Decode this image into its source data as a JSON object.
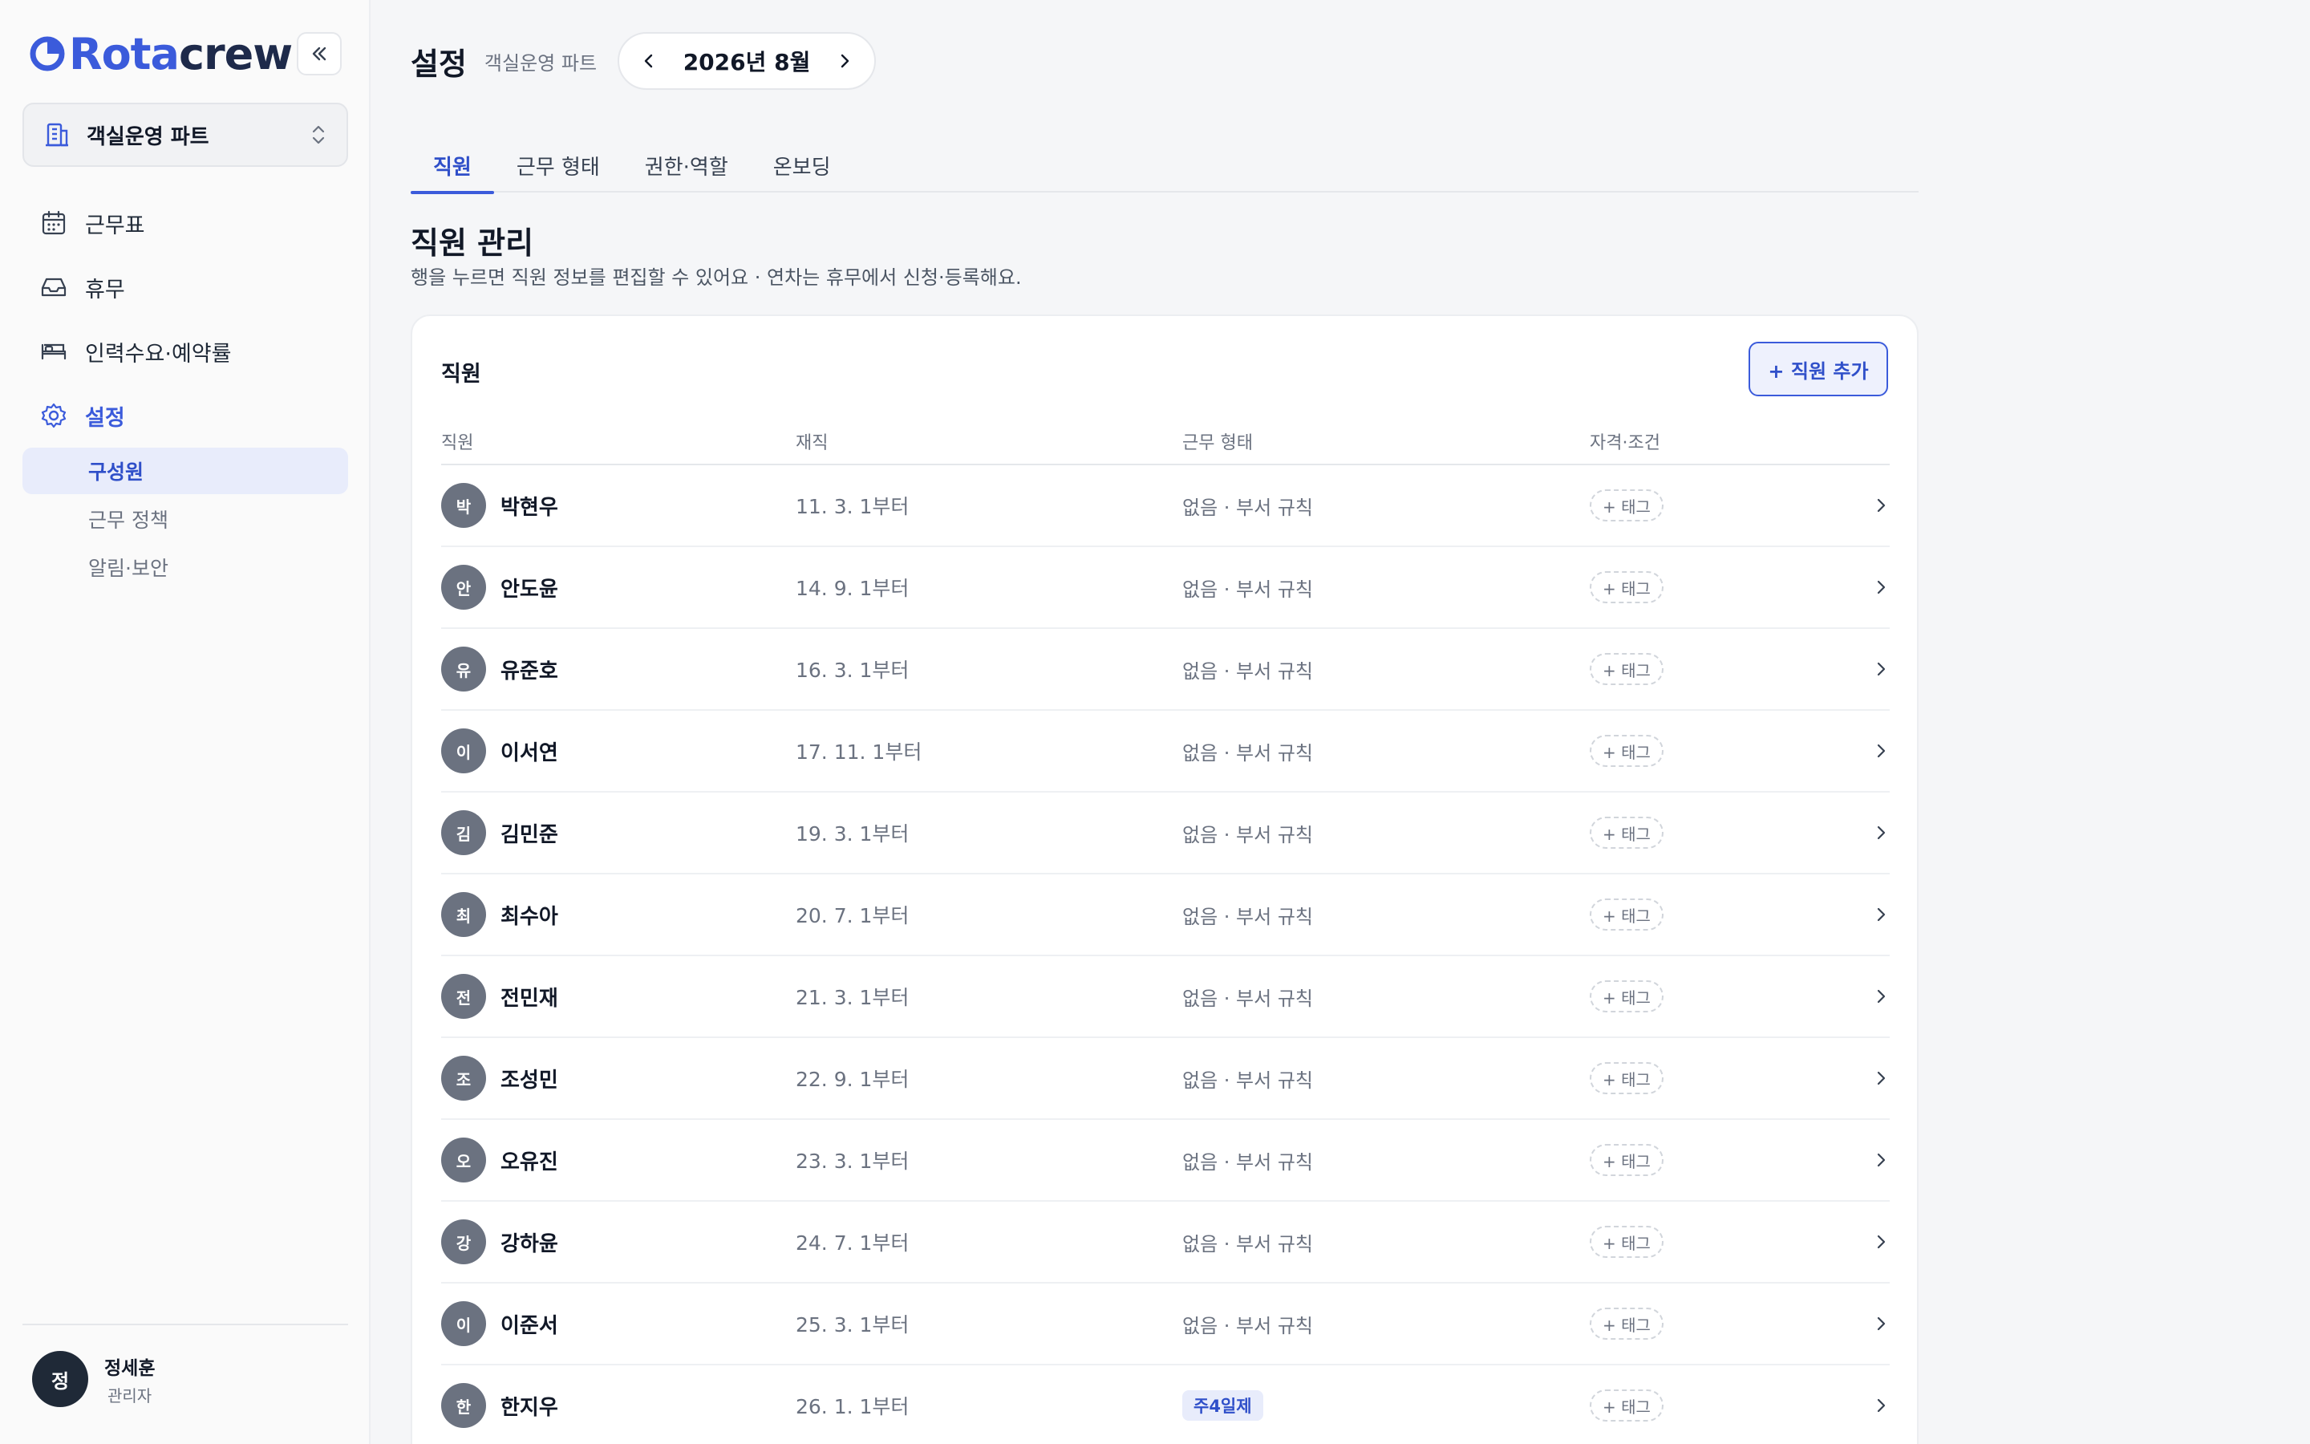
{
  "brand": {
    "part1": "Rota",
    "part2": "crew",
    "accent": "#3b5bdb"
  },
  "org": {
    "label": "객실운영 파트"
  },
  "nav": [
    {
      "label": "근무표",
      "icon": "calendar-icon"
    },
    {
      "label": "휴무",
      "icon": "inbox-icon"
    },
    {
      "label": "인력수요·예약률",
      "icon": "bed-icon"
    },
    {
      "label": "설정",
      "icon": "gear-icon"
    }
  ],
  "subnav": [
    "구성원",
    "근무 정책",
    "알림·보안"
  ],
  "user": {
    "initial": "정",
    "name": "정세훈",
    "role": "관리자"
  },
  "header": {
    "title": "설정",
    "subtitle": "객실운영 파트",
    "month": "2026년 8월"
  },
  "tabs": [
    "직원",
    "근무 형태",
    "권한·역할",
    "온보딩"
  ],
  "section": {
    "title": "직원 관리",
    "description": "행을 누르면 직원 정보를 편집할 수 있어요 · 연차는 휴무에서 신청·등록해요."
  },
  "card": {
    "title": "직원",
    "add_label": "+ 직원 추가"
  },
  "table": {
    "columns": [
      "직원",
      "재직",
      "근무 형태",
      "자격·조건"
    ],
    "tag_label": "+ 태그",
    "rows": [
      {
        "initial": "박",
        "name": "박현우",
        "since": "11. 3. 1부터",
        "type": "없음 · 부서 규칙"
      },
      {
        "initial": "안",
        "name": "안도윤",
        "since": "14. 9. 1부터",
        "type": "없음 · 부서 규칙"
      },
      {
        "initial": "유",
        "name": "유준호",
        "since": "16. 3. 1부터",
        "type": "없음 · 부서 규칙"
      },
      {
        "initial": "이",
        "name": "이서연",
        "since": "17. 11. 1부터",
        "type": "없음 · 부서 규칙"
      },
      {
        "initial": "김",
        "name": "김민준",
        "since": "19. 3. 1부터",
        "type": "없음 · 부서 규칙"
      },
      {
        "initial": "최",
        "name": "최수아",
        "since": "20. 7. 1부터",
        "type": "없음 · 부서 규칙"
      },
      {
        "initial": "전",
        "name": "전민재",
        "since": "21. 3. 1부터",
        "type": "없음 · 부서 규칙"
      },
      {
        "initial": "조",
        "name": "조성민",
        "since": "22. 9. 1부터",
        "type": "없음 · 부서 규칙"
      },
      {
        "initial": "오",
        "name": "오유진",
        "since": "23. 3. 1부터",
        "type": "없음 · 부서 규칙"
      },
      {
        "initial": "강",
        "name": "강하윤",
        "since": "24. 7. 1부터",
        "type": "없음 · 부서 규칙"
      },
      {
        "initial": "이",
        "name": "이준서",
        "since": "25. 3. 1부터",
        "type": "없음 · 부서 규칙"
      },
      {
        "initial": "한",
        "name": "한지우",
        "since": "26. 1. 1부터",
        "type": "주4일제",
        "badge": true
      }
    ]
  }
}
